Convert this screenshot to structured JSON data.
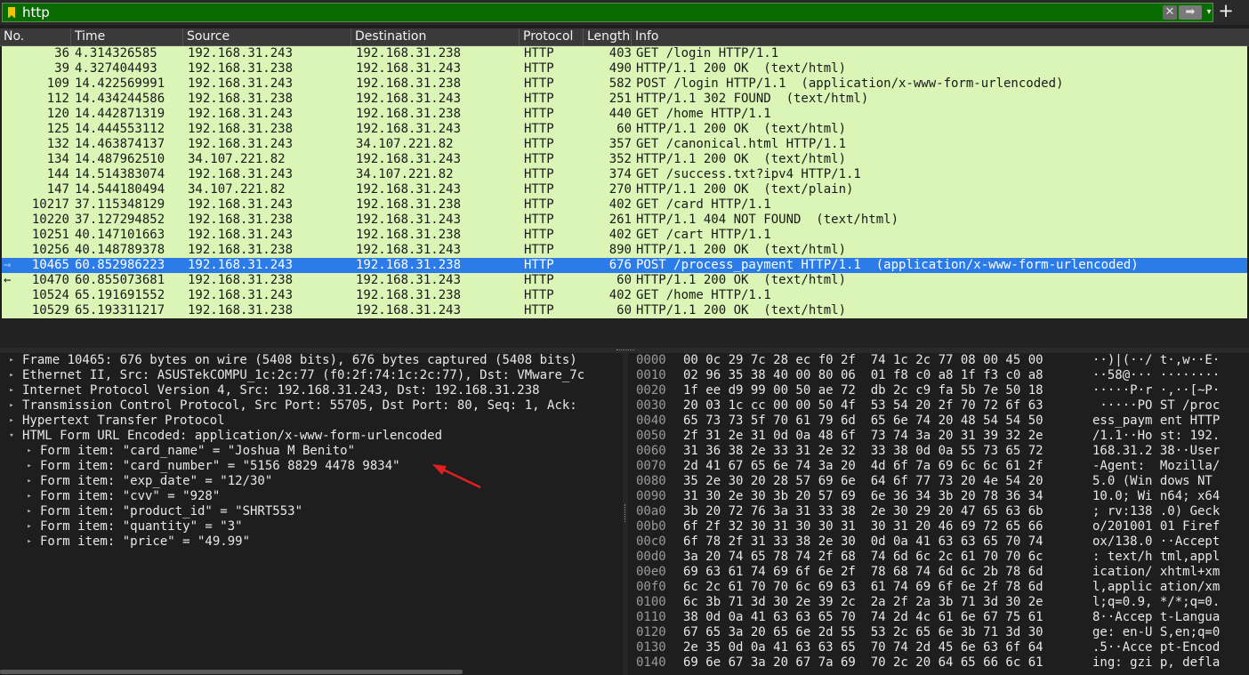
{
  "filter": {
    "value": "http",
    "clear_glyph": "✕",
    "apply_glyph": "➡",
    "history_glyph": "▾",
    "add_glyph": "+"
  },
  "columns": [
    "No.",
    "Time",
    "Source",
    "Destination",
    "Protocol",
    "Length",
    "Info"
  ],
  "packets": [
    {
      "no": "36",
      "time": "4.314326585",
      "src": "192.168.31.243",
      "dst": "192.168.31.238",
      "proto": "HTTP",
      "len": "403",
      "info": "GET /login HTTP/1.1"
    },
    {
      "no": "39",
      "time": "4.327404493",
      "src": "192.168.31.238",
      "dst": "192.168.31.243",
      "proto": "HTTP",
      "len": "490",
      "info": "HTTP/1.1 200 OK  (text/html)"
    },
    {
      "no": "109",
      "time": "14.422569991",
      "src": "192.168.31.243",
      "dst": "192.168.31.238",
      "proto": "HTTP",
      "len": "582",
      "info": "POST /login HTTP/1.1  (application/x-www-form-urlencoded)"
    },
    {
      "no": "112",
      "time": "14.434244586",
      "src": "192.168.31.238",
      "dst": "192.168.31.243",
      "proto": "HTTP",
      "len": "251",
      "info": "HTTP/1.1 302 FOUND  (text/html)"
    },
    {
      "no": "120",
      "time": "14.442871319",
      "src": "192.168.31.243",
      "dst": "192.168.31.238",
      "proto": "HTTP",
      "len": "440",
      "info": "GET /home HTTP/1.1"
    },
    {
      "no": "125",
      "time": "14.444553112",
      "src": "192.168.31.238",
      "dst": "192.168.31.243",
      "proto": "HTTP",
      "len": "60",
      "info": "HTTP/1.1 200 OK  (text/html)"
    },
    {
      "no": "132",
      "time": "14.463874137",
      "src": "192.168.31.243",
      "dst": "34.107.221.82",
      "proto": "HTTP",
      "len": "357",
      "info": "GET /canonical.html HTTP/1.1"
    },
    {
      "no": "134",
      "time": "14.487962510",
      "src": "34.107.221.82",
      "dst": "192.168.31.243",
      "proto": "HTTP",
      "len": "352",
      "info": "HTTP/1.1 200 OK  (text/html)"
    },
    {
      "no": "144",
      "time": "14.514383074",
      "src": "192.168.31.243",
      "dst": "34.107.221.82",
      "proto": "HTTP",
      "len": "374",
      "info": "GET /success.txt?ipv4 HTTP/1.1"
    },
    {
      "no": "147",
      "time": "14.544180494",
      "src": "34.107.221.82",
      "dst": "192.168.31.243",
      "proto": "HTTP",
      "len": "270",
      "info": "HTTP/1.1 200 OK  (text/plain)"
    },
    {
      "no": "10217",
      "time": "37.115348129",
      "src": "192.168.31.243",
      "dst": "192.168.31.238",
      "proto": "HTTP",
      "len": "402",
      "info": "GET /card HTTP/1.1"
    },
    {
      "no": "10220",
      "time": "37.127294852",
      "src": "192.168.31.238",
      "dst": "192.168.31.243",
      "proto": "HTTP",
      "len": "261",
      "info": "HTTP/1.1 404 NOT FOUND  (text/html)"
    },
    {
      "no": "10251",
      "time": "40.147101663",
      "src": "192.168.31.243",
      "dst": "192.168.31.238",
      "proto": "HTTP",
      "len": "402",
      "info": "GET /cart HTTP/1.1"
    },
    {
      "no": "10256",
      "time": "40.148789378",
      "src": "192.168.31.238",
      "dst": "192.168.31.243",
      "proto": "HTTP",
      "len": "890",
      "info": "HTTP/1.1 200 OK  (text/html)"
    },
    {
      "no": "10465",
      "time": "60.852986223",
      "src": "192.168.31.243",
      "dst": "192.168.31.238",
      "proto": "HTTP",
      "len": "676",
      "info": "POST /process_payment HTTP/1.1  (application/x-www-form-urlencoded)",
      "selected": true,
      "marker": "→"
    },
    {
      "no": "10470",
      "time": "60.855073681",
      "src": "192.168.31.238",
      "dst": "192.168.31.243",
      "proto": "HTTP",
      "len": "60",
      "info": "HTTP/1.1 200 OK  (text/html)",
      "marker": "←"
    },
    {
      "no": "10524",
      "time": "65.191691552",
      "src": "192.168.31.243",
      "dst": "192.168.31.238",
      "proto": "HTTP",
      "len": "402",
      "info": "GET /home HTTP/1.1"
    },
    {
      "no": "10529",
      "time": "65.193311217",
      "src": "192.168.31.238",
      "dst": "192.168.31.243",
      "proto": "HTTP",
      "len": "60",
      "info": "HTTP/1.1 200 OK  (text/html)"
    }
  ],
  "details": [
    {
      "level": 0,
      "state": "collapsed",
      "text": "Frame 10465: 676 bytes on wire (5408 bits), 676 bytes captured (5408 bits)"
    },
    {
      "level": 0,
      "state": "collapsed",
      "text": "Ethernet II, Src: ASUSTekCOMPU_1c:2c:77 (f0:2f:74:1c:2c:77), Dst: VMware_7c"
    },
    {
      "level": 0,
      "state": "collapsed",
      "text": "Internet Protocol Version 4, Src: 192.168.31.243, Dst: 192.168.31.238"
    },
    {
      "level": 0,
      "state": "collapsed",
      "text": "Transmission Control Protocol, Src Port: 55705, Dst Port: 80, Seq: 1, Ack:"
    },
    {
      "level": 0,
      "state": "collapsed",
      "text": "Hypertext Transfer Protocol"
    },
    {
      "level": 0,
      "state": "expanded",
      "text": "HTML Form URL Encoded: application/x-www-form-urlencoded"
    },
    {
      "level": 1,
      "state": "collapsed",
      "text": "Form item: \"card_name\" = \"Joshua M Benito\""
    },
    {
      "level": 1,
      "state": "collapsed",
      "text": "Form item: \"card_number\" = \"5156 8829 4478 9834\""
    },
    {
      "level": 1,
      "state": "collapsed",
      "text": "Form item: \"exp_date\" = \"12/30\""
    },
    {
      "level": 1,
      "state": "collapsed",
      "text": "Form item: \"cvv\" = \"928\""
    },
    {
      "level": 1,
      "state": "collapsed",
      "text": "Form item: \"product_id\" = \"SHRT553\""
    },
    {
      "level": 1,
      "state": "collapsed",
      "text": "Form item: \"quantity\" = \"3\""
    },
    {
      "level": 1,
      "state": "collapsed",
      "text": "Form item: \"price\" = \"49.99\""
    }
  ],
  "bytes": [
    {
      "off": "0000",
      "hex": "00 0c 29 7c 28 ec f0 2f  74 1c 2c 77 08 00 45 00",
      "ascii": "··)|(··/ t·,w··E·"
    },
    {
      "off": "0010",
      "hex": "02 96 35 38 40 00 80 06  01 f8 c0 a8 1f f3 c0 a8",
      "ascii": "··58@··· ········"
    },
    {
      "off": "0020",
      "hex": "1f ee d9 99 00 50 ae 72  db 2c c9 fa 5b 7e 50 18",
      "ascii": "·····P·r ·,··[~P·"
    },
    {
      "off": "0030",
      "hex": "20 03 1c cc 00 00 50 4f  53 54 20 2f 70 72 6f 63",
      "ascii": " ·····PO ST /proc"
    },
    {
      "off": "0040",
      "hex": "65 73 73 5f 70 61 79 6d  65 6e 74 20 48 54 54 50",
      "ascii": "ess_paym ent HTTP"
    },
    {
      "off": "0050",
      "hex": "2f 31 2e 31 0d 0a 48 6f  73 74 3a 20 31 39 32 2e",
      "ascii": "/1.1··Ho st: 192."
    },
    {
      "off": "0060",
      "hex": "31 36 38 2e 33 31 2e 32  33 38 0d 0a 55 73 65 72",
      "ascii": "168.31.2 38··User"
    },
    {
      "off": "0070",
      "hex": "2d 41 67 65 6e 74 3a 20  4d 6f 7a 69 6c 6c 61 2f",
      "ascii": "-Agent:  Mozilla/"
    },
    {
      "off": "0080",
      "hex": "35 2e 30 20 28 57 69 6e  64 6f 77 73 20 4e 54 20",
      "ascii": "5.0 (Win dows NT "
    },
    {
      "off": "0090",
      "hex": "31 30 2e 30 3b 20 57 69  6e 36 34 3b 20 78 36 34",
      "ascii": "10.0; Wi n64; x64"
    },
    {
      "off": "00a0",
      "hex": "3b 20 72 76 3a 31 33 38  2e 30 29 20 47 65 63 6b",
      "ascii": "; rv:138 .0) Geck"
    },
    {
      "off": "00b0",
      "hex": "6f 2f 32 30 31 30 30 31  30 31 20 46 69 72 65 66",
      "ascii": "o/201001 01 Firef"
    },
    {
      "off": "00c0",
      "hex": "6f 78 2f 31 33 38 2e 30  0d 0a 41 63 63 65 70 74",
      "ascii": "ox/138.0 ··Accept"
    },
    {
      "off": "00d0",
      "hex": "3a 20 74 65 78 74 2f 68  74 6d 6c 2c 61 70 70 6c",
      "ascii": ": text/h tml,appl"
    },
    {
      "off": "00e0",
      "hex": "69 63 61 74 69 6f 6e 2f  78 68 74 6d 6c 2b 78 6d",
      "ascii": "ication/ xhtml+xm"
    },
    {
      "off": "00f0",
      "hex": "6c 2c 61 70 70 6c 69 63  61 74 69 6f 6e 2f 78 6d",
      "ascii": "l,applic ation/xm"
    },
    {
      "off": "0100",
      "hex": "6c 3b 71 3d 30 2e 39 2c  2a 2f 2a 3b 71 3d 30 2e",
      "ascii": "l;q=0.9, */*;q=0."
    },
    {
      "off": "0110",
      "hex": "38 0d 0a 41 63 63 65 70  74 2d 4c 61 6e 67 75 61",
      "ascii": "8··Accep t-Langua"
    },
    {
      "off": "0120",
      "hex": "67 65 3a 20 65 6e 2d 55  53 2c 65 6e 3b 71 3d 30",
      "ascii": "ge: en-U S,en;q=0"
    },
    {
      "off": "0130",
      "hex": "2e 35 0d 0a 41 63 63 65  70 74 2d 45 6e 63 6f 64",
      "ascii": ".5··Acce pt-Encod"
    },
    {
      "off": "0140",
      "hex": "69 6e 67 3a 20 67 7a 69  70 2c 20 64 65 66 6c 61",
      "ascii": "ing: gzi p, defla"
    }
  ],
  "colors": {
    "filter_bg": "#096c00",
    "row_bg": "#daf5b5",
    "selected_bg": "#2b7be8",
    "annotation_arrow": "#e02020"
  },
  "icons": {
    "bookmark": "bookmark-icon",
    "clear": "clear-filter-icon",
    "apply": "apply-filter-icon",
    "history": "filter-history-icon",
    "add": "add-filter-icon"
  }
}
